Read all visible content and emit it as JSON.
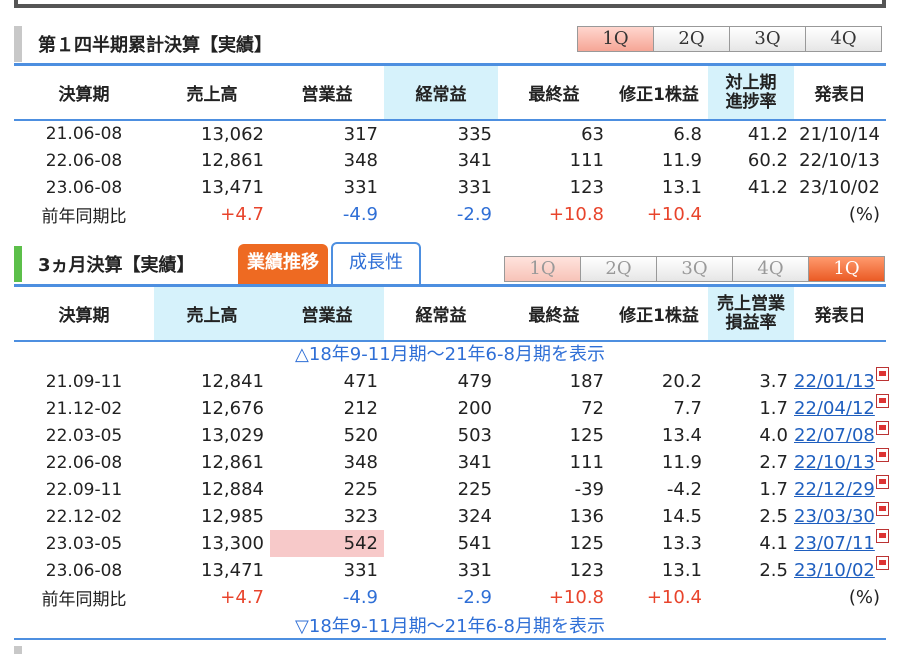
{
  "section1": {
    "title": "第１四半期累計決算【実績】",
    "quarter_tabs": [
      "1Q",
      "2Q",
      "3Q",
      "4Q"
    ],
    "headers": [
      "決算期",
      "売上高",
      "営業益",
      "経常益",
      "最終益",
      "修正1株益",
      "対上期\n進捗率",
      "発表日"
    ],
    "rows": [
      [
        "21.06-08",
        "13,062",
        "317",
        "335",
        "63",
        "6.8",
        "41.2",
        "21/10/14"
      ],
      [
        "22.06-08",
        "12,861",
        "348",
        "341",
        "111",
        "11.9",
        "60.2",
        "22/10/13"
      ],
      [
        "23.06-08",
        "13,471",
        "331",
        "331",
        "123",
        "13.1",
        "41.2",
        "23/10/02"
      ]
    ],
    "yoy": [
      "前年同期比",
      "+4.7",
      "-4.9",
      "-2.9",
      "+10.8",
      "+10.4",
      "",
      "(%)"
    ]
  },
  "section2": {
    "title": "3ヵ月決算【実績】",
    "tab_results": "業績推移",
    "tab_growth": "成長性",
    "quarter_tabs": [
      "1Q",
      "2Q",
      "3Q",
      "4Q",
      "1Q"
    ],
    "headers": [
      "決算期",
      "売上高",
      "営業益",
      "経常益",
      "最終益",
      "修正1株益",
      "売上営業\n損益率",
      "発表日"
    ],
    "toggle_top": "△18年9-11月期～21年6-8月期を表示",
    "toggle_bottom": "▽18年9-11月期～21年6-8月期を表示",
    "rows": [
      [
        "21.09-11",
        "12,841",
        "471",
        "479",
        "187",
        "20.2",
        "3.7",
        "22/01/13"
      ],
      [
        "21.12-02",
        "12,676",
        "212",
        "200",
        "72",
        "7.7",
        "1.7",
        "22/04/12"
      ],
      [
        "22.03-05",
        "13,029",
        "520",
        "503",
        "125",
        "13.4",
        "4.0",
        "22/07/08"
      ],
      [
        "22.06-08",
        "12,861",
        "348",
        "341",
        "111",
        "11.9",
        "2.7",
        "22/10/13"
      ],
      [
        "22.09-11",
        "12,884",
        "225",
        "225",
        "-39",
        "-4.2",
        "1.7",
        "22/12/29"
      ],
      [
        "22.12-02",
        "12,985",
        "323",
        "324",
        "136",
        "14.5",
        "2.5",
        "23/03/30"
      ],
      [
        "23.03-05",
        "13,300",
        "542",
        "541",
        "125",
        "13.3",
        "4.1",
        "23/07/11"
      ],
      [
        "23.06-08",
        "13,471",
        "331",
        "331",
        "123",
        "13.1",
        "2.5",
        "23/10/02"
      ]
    ],
    "yoy": [
      "前年同期比",
      "+4.7",
      "-4.9",
      "-2.9",
      "+10.8",
      "+10.4",
      "",
      "(%)"
    ]
  },
  "colors": {
    "accent_blue": "#4d8fe0",
    "highlight_cyan": "#d6f2fb",
    "positive": "#e8442c",
    "negative": "#2f6fd6",
    "orange_tab": "#ee6a22"
  }
}
